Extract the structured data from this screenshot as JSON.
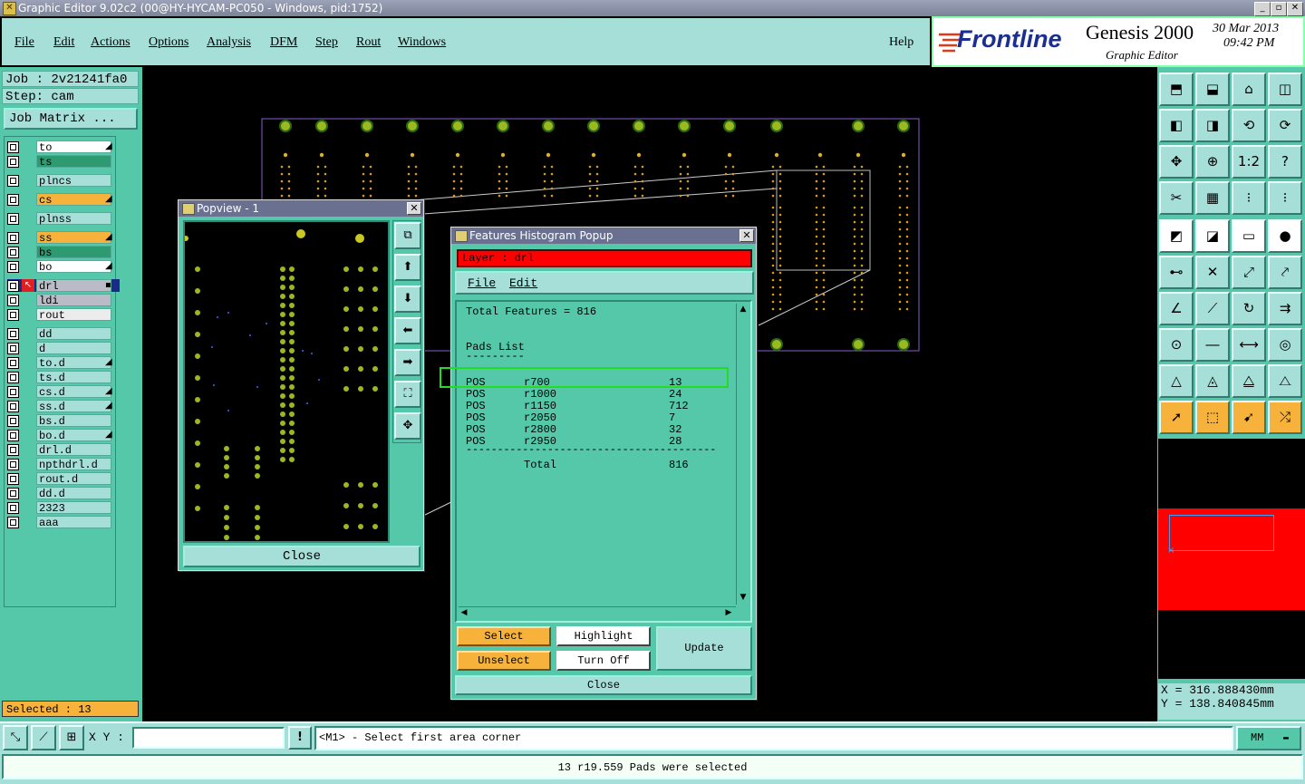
{
  "window": {
    "title": "Graphic Editor 9.02c2 (00@HY-HYCAM-PC050 - Windows, pid:1752)",
    "controls": [
      "_",
      "▫",
      "✕"
    ]
  },
  "menu": {
    "items": [
      "File",
      "Edit",
      "Actions",
      "Options",
      "Analysis",
      "DFM",
      "Step",
      "Rout",
      "Windows"
    ],
    "help": "Help"
  },
  "logo": {
    "brand": "Frontline",
    "product": "Genesis 2000",
    "subtitle": "Graphic Editor",
    "date": "30 Mar 2013",
    "time": "09:42 PM"
  },
  "job": {
    "job_label": "Job : 2v21241fa0",
    "step_label": "Step: cam",
    "matrix_button": "Job Matrix ..."
  },
  "layers": [
    {
      "name": "to",
      "color": "#ffffff",
      "mark": true
    },
    {
      "name": "ts",
      "color": "#2e9a72"
    },
    {
      "name": "plncs",
      "color": "#a6ded8"
    },
    {
      "name": "cs",
      "color": "#f6b23a",
      "mark": true
    },
    {
      "name": "plnss",
      "color": "#a6ded8"
    },
    {
      "name": "ss",
      "color": "#f6b23a",
      "mark": true
    },
    {
      "name": "bs",
      "color": "#2e9a72"
    },
    {
      "name": "bo",
      "color": "#ffffff",
      "mark": true
    },
    {
      "name": "drl",
      "color": "#b9bcc6",
      "active": true
    },
    {
      "name": "ldi",
      "color": "#b9bcc6"
    },
    {
      "name": "rout",
      "color": "#ececec"
    },
    {
      "name": "dd",
      "color": "#a6ded8"
    },
    {
      "name": "d",
      "color": "#a6ded8"
    },
    {
      "name": "to.d",
      "color": "#a6ded8",
      "mark": true
    },
    {
      "name": "ts.d",
      "color": "#a6ded8"
    },
    {
      "name": "cs.d",
      "color": "#a6ded8",
      "mark": true
    },
    {
      "name": "ss.d",
      "color": "#a6ded8",
      "mark": true
    },
    {
      "name": "bs.d",
      "color": "#a6ded8"
    },
    {
      "name": "bo.d",
      "color": "#a6ded8",
      "mark": true
    },
    {
      "name": "drl.d",
      "color": "#a6ded8"
    },
    {
      "name": "npthdrl.d",
      "color": "#a6ded8"
    },
    {
      "name": "rout.d",
      "color": "#a6ded8"
    },
    {
      "name": "dd.d",
      "color": "#a6ded8"
    },
    {
      "name": "2323",
      "color": "#a6ded8"
    },
    {
      "name": "aaa",
      "color": "#a6ded8"
    }
  ],
  "selected_label": "Selected : 13",
  "popview": {
    "title": "Popview - 1",
    "close": "Close"
  },
  "histogram": {
    "title": "Features Histogram Popup",
    "layer_label": "Layer :  drl",
    "menu": [
      "File",
      "Edit"
    ],
    "total_features": "Total Features = 816",
    "pads_heading": "Pads List",
    "pads_underline": "---------",
    "rows": [
      {
        "pol": "POS",
        "sym": "r700",
        "count": "13"
      },
      {
        "pol": "POS",
        "sym": "r1000",
        "count": "24"
      },
      {
        "pol": "POS",
        "sym": "r1150",
        "count": "712"
      },
      {
        "pol": "POS",
        "sym": "r2050",
        "count": "7"
      },
      {
        "pol": "POS",
        "sym": "r2800",
        "count": "32"
      },
      {
        "pol": "POS",
        "sym": "r2950",
        "count": "28"
      }
    ],
    "separator": "----------------------------------------",
    "total_label": "Total",
    "total_value": "816",
    "buttons": {
      "select": "Select",
      "unselect": "Unselect",
      "highlight": "Highlight",
      "turn_off": "Turn Off",
      "update": "Update",
      "close": "Close"
    }
  },
  "coords": {
    "x": "X  =  316.888430mm",
    "y": "Y  =  138.840845mm"
  },
  "cmd": {
    "xy_label": "X Y :",
    "xy_value": "",
    "excl": "!",
    "prompt": "<M1> - Select first area corner",
    "units": "MM"
  },
  "status_message": "13 r19.559 Pads were selected",
  "colors": {
    "teal": "#54c8a8",
    "light_teal": "#a6ded8",
    "orange": "#f6b23a",
    "layer_red": "#ff0000",
    "highlight_green": "#22dd22",
    "pad_yellow": "#c8c820"
  }
}
